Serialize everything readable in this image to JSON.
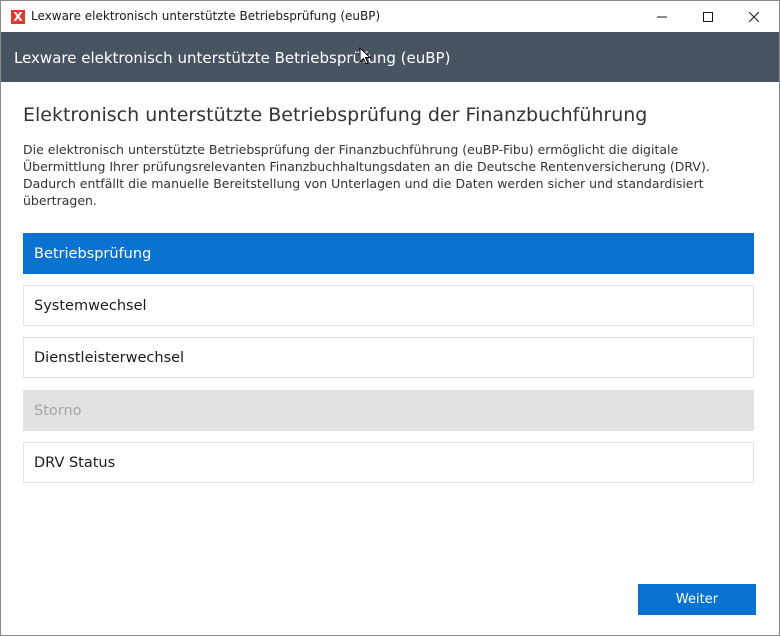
{
  "window": {
    "title": "Lexware elektronisch unterstützte Betriebsprüfung (euBP)",
    "app_icon_glyph": "X",
    "controls": [
      "minimize-icon",
      "maximize-icon",
      "close-icon"
    ]
  },
  "header": {
    "title": "Lexware elektronisch unterstützte Betriebsprüfung (euBP)"
  },
  "main": {
    "title": "Elektronisch unterstützte Betriebsprüfung der Finanzbuchführung",
    "description": "Die elektronisch unterstützte Betriebsprüfung der Finanzbuchführung (euBP-Fibu) ermöglicht die digitale Übermittlung Ihrer prüfungsrelevanten Finanzbuchhaltungsdaten an die Deutsche Rentenversicherung (DRV). Dadurch entfällt die manuelle Bereitstellung von Unterlagen und die Daten werden sicher und standardisiert übertragen.",
    "options": [
      {
        "label": "Betriebsprüfung",
        "state": "selected"
      },
      {
        "label": "Systemwechsel",
        "state": "normal"
      },
      {
        "label": "Dienstleisterwechsel",
        "state": "normal"
      },
      {
        "label": "Storno",
        "state": "disabled"
      },
      {
        "label": "DRV Status",
        "state": "normal"
      }
    ]
  },
  "footer": {
    "next_label": "Weiter"
  },
  "colors": {
    "accent": "#0a73d1",
    "header_bg": "#495462",
    "app_icon": "#e03a30",
    "disabled_bg": "#e2e2e2"
  }
}
